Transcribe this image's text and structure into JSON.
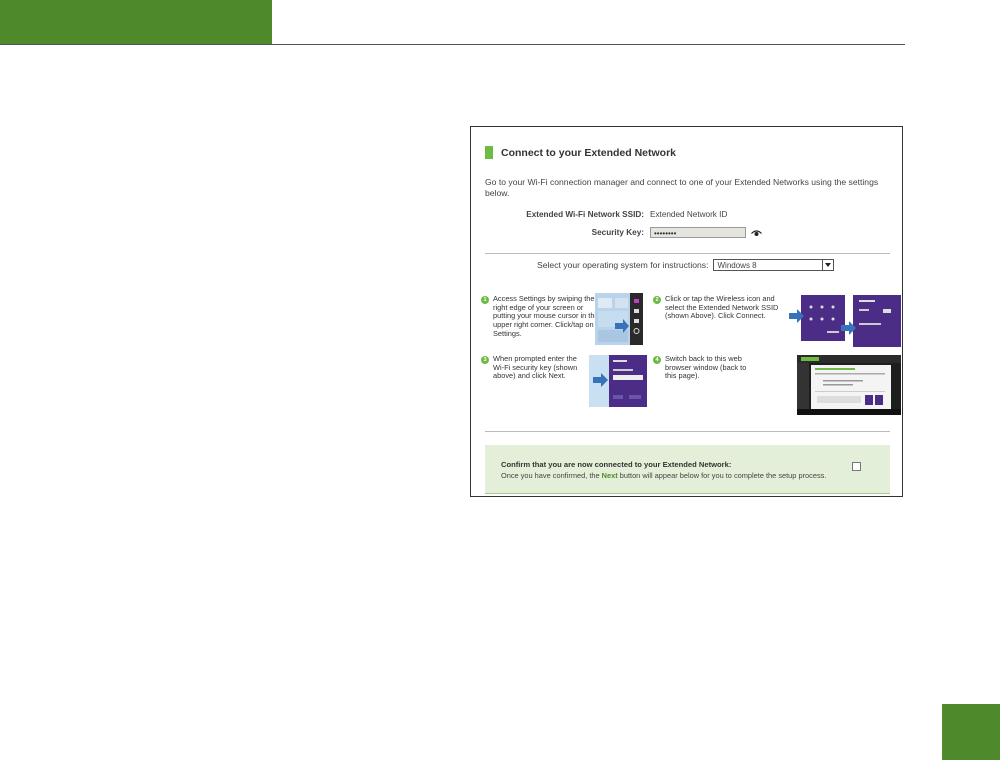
{
  "colors": {
    "brand_green": "#4e8a2c",
    "accent_green": "#6dbb43",
    "confirm_bg": "#e4efd9"
  },
  "panel": {
    "heading": "Connect to your Extended Network",
    "intro": "Go to your Wi-Fi connection manager and connect to one of your Extended Networks using the settings below.",
    "ssid_label": "Extended Wi-Fi Network SSID:",
    "ssid_value": "Extended Network ID",
    "key_label": "Security Key:",
    "key_value": "••••••••",
    "os_prompt": "Select your operating system for instructions:",
    "os_selected": "Windows 8",
    "steps": [
      {
        "num": "1",
        "text": "Access Settings by swiping the right edge of your screen or putting your mouse cursor in the upper right corner. Click/tap on Settings."
      },
      {
        "num": "2",
        "text": "Click or tap the Wireless icon and select the Extended Network SSID (shown Above). Click Connect."
      },
      {
        "num": "3",
        "text": "When prompted enter the Wi-Fi security key (shown above) and click Next."
      },
      {
        "num": "4",
        "text": "Switch back to this web browser window (back to this page)."
      }
    ],
    "confirm_title": "Confirm that you are now connected to your Extended Network:",
    "confirm_pre": "Once you have confirmed, the ",
    "confirm_next": "Next",
    "confirm_post": " button will appear below for you to complete the setup process."
  }
}
